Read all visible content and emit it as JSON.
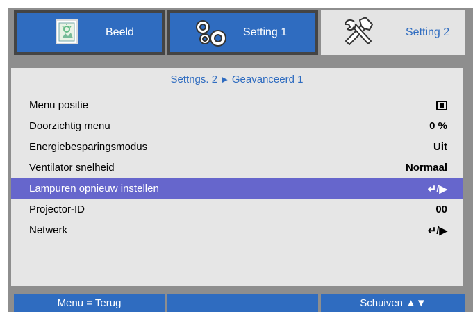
{
  "tabs": [
    {
      "label": "Beeld",
      "icon": "picture-icon",
      "state": "inactive"
    },
    {
      "label": "Setting 1",
      "icon": "gears-icon",
      "state": "inactive"
    },
    {
      "label": "Setting 2",
      "icon": "tools-icon",
      "state": "active"
    }
  ],
  "breadcrumb": {
    "parent": "Settngs. 2",
    "separator": "▶",
    "current": "Geavanceerd 1"
  },
  "rows": [
    {
      "label": "Menu positie",
      "value": "",
      "value_icon": "menu-position-icon"
    },
    {
      "label": "Doorzichtig menu",
      "value": "0 %"
    },
    {
      "label": "Energiebesparingsmodus",
      "value": "Uit"
    },
    {
      "label": "Ventilator snelheid",
      "value": "Normaal"
    },
    {
      "label": "Lampuren opnieuw instellen",
      "value": "↵/▶",
      "selected": true
    },
    {
      "label": "Projector-ID",
      "value": "00"
    },
    {
      "label": "Netwerk",
      "value": "↵/▶"
    }
  ],
  "footer": {
    "left": "Menu = Terug",
    "middle": "",
    "right": "Schuiven ▲▼"
  },
  "colors": {
    "frame": "#8e8e8e",
    "tab_blue": "#2f6cc0",
    "panel": "#e6e6e6",
    "highlight": "#6666cc"
  }
}
